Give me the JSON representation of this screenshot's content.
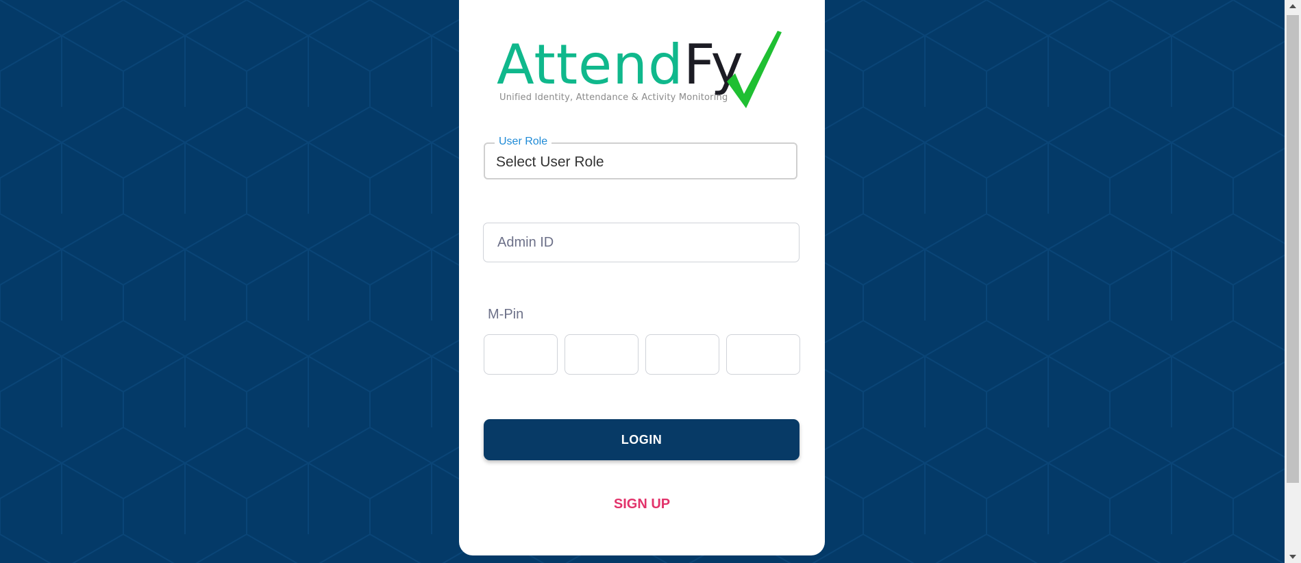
{
  "logo": {
    "word_part1": "Attend",
    "word_part2": "Fy",
    "tagline": "Unified Identity, Attendance & Activity Monitoring",
    "colors": {
      "green": "#10b88c",
      "dark": "#1c1c24",
      "check": "#1fbf32"
    }
  },
  "form": {
    "user_role": {
      "label": "User Role",
      "value": "Select User Role"
    },
    "admin_id": {
      "placeholder": "Admin ID",
      "value": ""
    },
    "mpin": {
      "label": "M-Pin",
      "digits": [
        "",
        "",
        "",
        ""
      ]
    },
    "login_label": "LOGIN",
    "signup_label": "SIGN UP"
  },
  "colors": {
    "background": "#043a68",
    "primary_button": "#073a66",
    "accent_pink": "#e2336b",
    "label_blue": "#1e8ad6"
  },
  "icons": {
    "check": "checkmark-icon",
    "scroll_up": "triangle-up-icon",
    "scroll_down": "triangle-down-icon"
  }
}
